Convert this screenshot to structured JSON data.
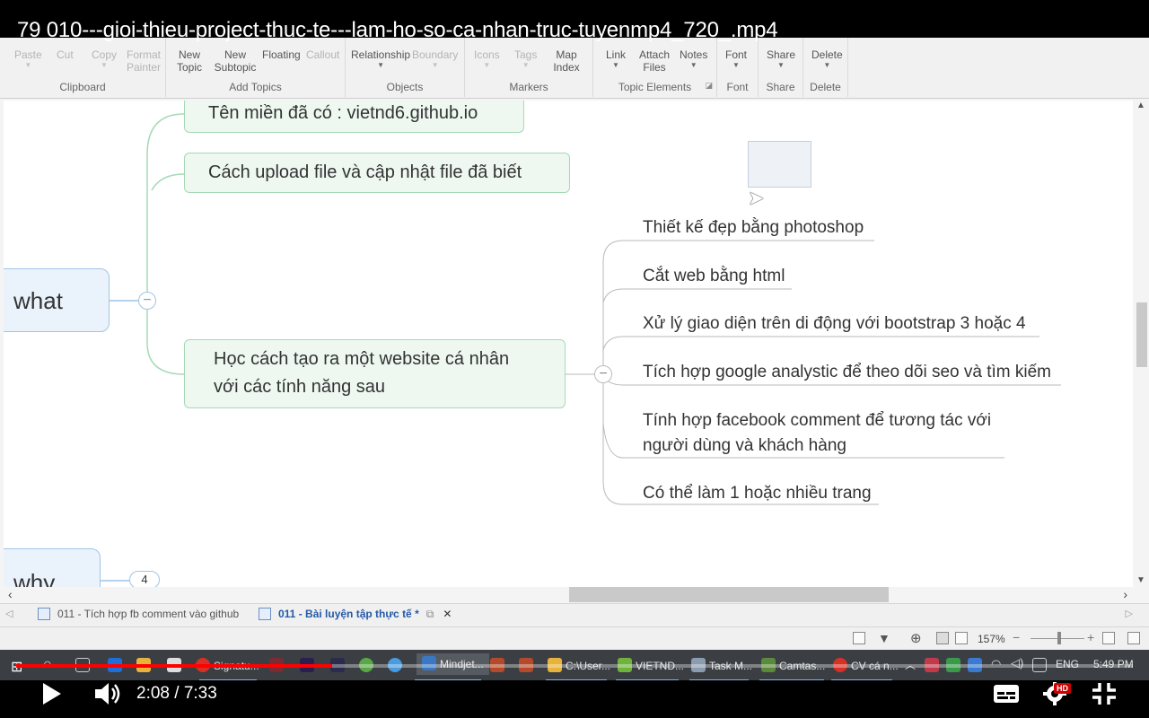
{
  "player": {
    "title": "79 010---gioi-thieu-project-thuc-te---lam-ho-so-ca-nhan-truc-tuyenmp4_720_.mp4",
    "time": "2:08 / 7:33",
    "progress": 0.283,
    "hd_badge": "HD",
    "accent": "#ff0000"
  },
  "ribbon": {
    "groups": [
      {
        "label": "Clipboard",
        "buttons": [
          "Paste",
          "Cut",
          "Copy",
          "Format Painter"
        ]
      },
      {
        "label": "Add Topics",
        "buttons": [
          "New Topic",
          "New Subtopic",
          "Floating",
          "Callout"
        ]
      },
      {
        "label": "Objects",
        "buttons": [
          "Relationship",
          "Boundary"
        ]
      },
      {
        "label": "Markers",
        "buttons": [
          "Icons",
          "Tags",
          "Map Index"
        ]
      },
      {
        "label": "Topic Elements",
        "buttons": [
          "Link",
          "Attach Files",
          "Notes"
        ]
      },
      {
        "label": "Font",
        "buttons": [
          "Font"
        ]
      },
      {
        "label": "Share",
        "buttons": [
          "Share"
        ]
      },
      {
        "label": "Delete",
        "buttons": [
          "Delete"
        ]
      }
    ]
  },
  "map": {
    "main_topics": [
      "what",
      "why"
    ],
    "why_badge": "4",
    "topics": [
      "Tên miền đã có : vietnd6.github.io",
      "Cách upload file và cập nhật file đã biết",
      "Học cách tạo ra một website cá nhân",
      "với các tính năng sau"
    ],
    "subtopics": [
      "Thiết kế đẹp bằng photoshop",
      "Cắt web bằng html",
      "Xử lý giao diện trên di động với bootstrap 3 hoặc 4",
      "Tích hợp google analystic để theo dõi seo và tìm kiếm",
      "Tính hợp facebook comment để tương tác với",
      "người dùng và khách hàng",
      "Có thể làm 1 hoặc nhiều trang"
    ],
    "collapse_symbol": "−"
  },
  "doc_tabs": [
    "011 - Tích hợp fb comment vào github",
    "011 - Bài luyện tập thực tế *"
  ],
  "status": {
    "zoom": "157%"
  },
  "taskbar": {
    "items": [
      "Signatu...",
      "Mindjet...",
      "C:\\User...",
      "VIETND...",
      "Task M...",
      "Camtas...",
      "CV cá n..."
    ],
    "lang": "ENG",
    "clock": "5:49 PM"
  }
}
